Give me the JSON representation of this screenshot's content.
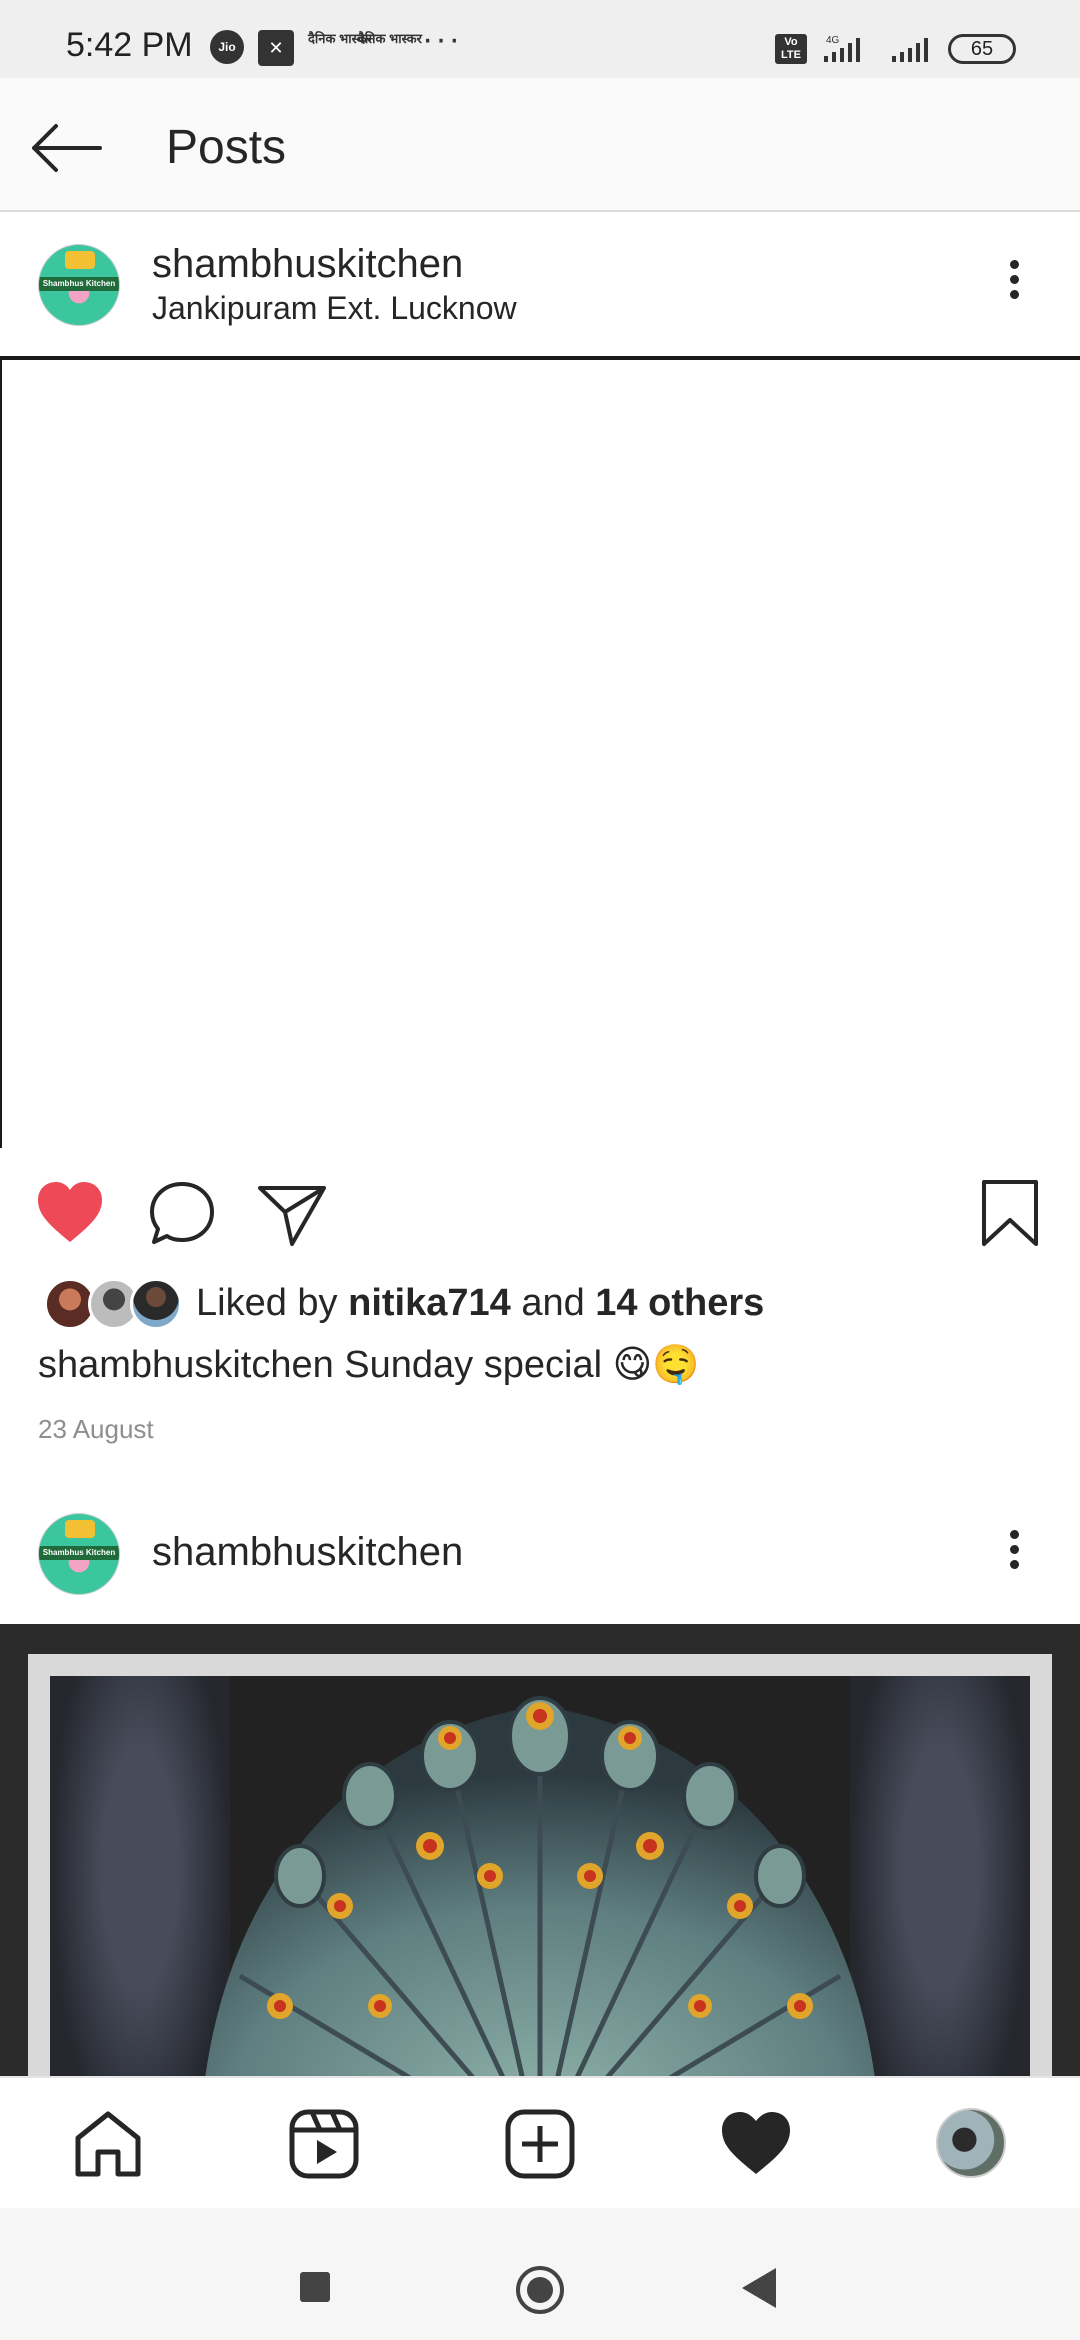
{
  "status_bar": {
    "time": "5:42 PM",
    "carrier_icon_label": "Jio",
    "app_icon_name": "news-app-icon",
    "news_icon_label": "दैनिक भास्कर",
    "overflow": "···",
    "volte_label": "Vo LTE",
    "network_label": "4G",
    "battery": "65"
  },
  "topbar": {
    "title": "Posts"
  },
  "posts": [
    {
      "username": "shambhuskitchen",
      "location": "Jankipuram Ext. Lucknow",
      "avatar_band_text": "Shambhus Kitchen",
      "liked": true,
      "likes": {
        "prefix": "Liked by",
        "user": "nitika714",
        "middle": "and",
        "others": "14 others"
      },
      "caption_user": "shambhuskitchen",
      "caption_text": "Sunday special 😋🤤",
      "date": "23 August"
    },
    {
      "username": "shambhuskitchen",
      "avatar_band_text": "Shambhus Kitchen"
    }
  ],
  "colors": {
    "like_red": "#ed4956",
    "text": "#262626",
    "muted": "#8e8e8e"
  },
  "bottom_nav": {
    "items": [
      "home-icon",
      "reels-icon",
      "create-icon",
      "activity-icon",
      "profile-avatar"
    ]
  }
}
